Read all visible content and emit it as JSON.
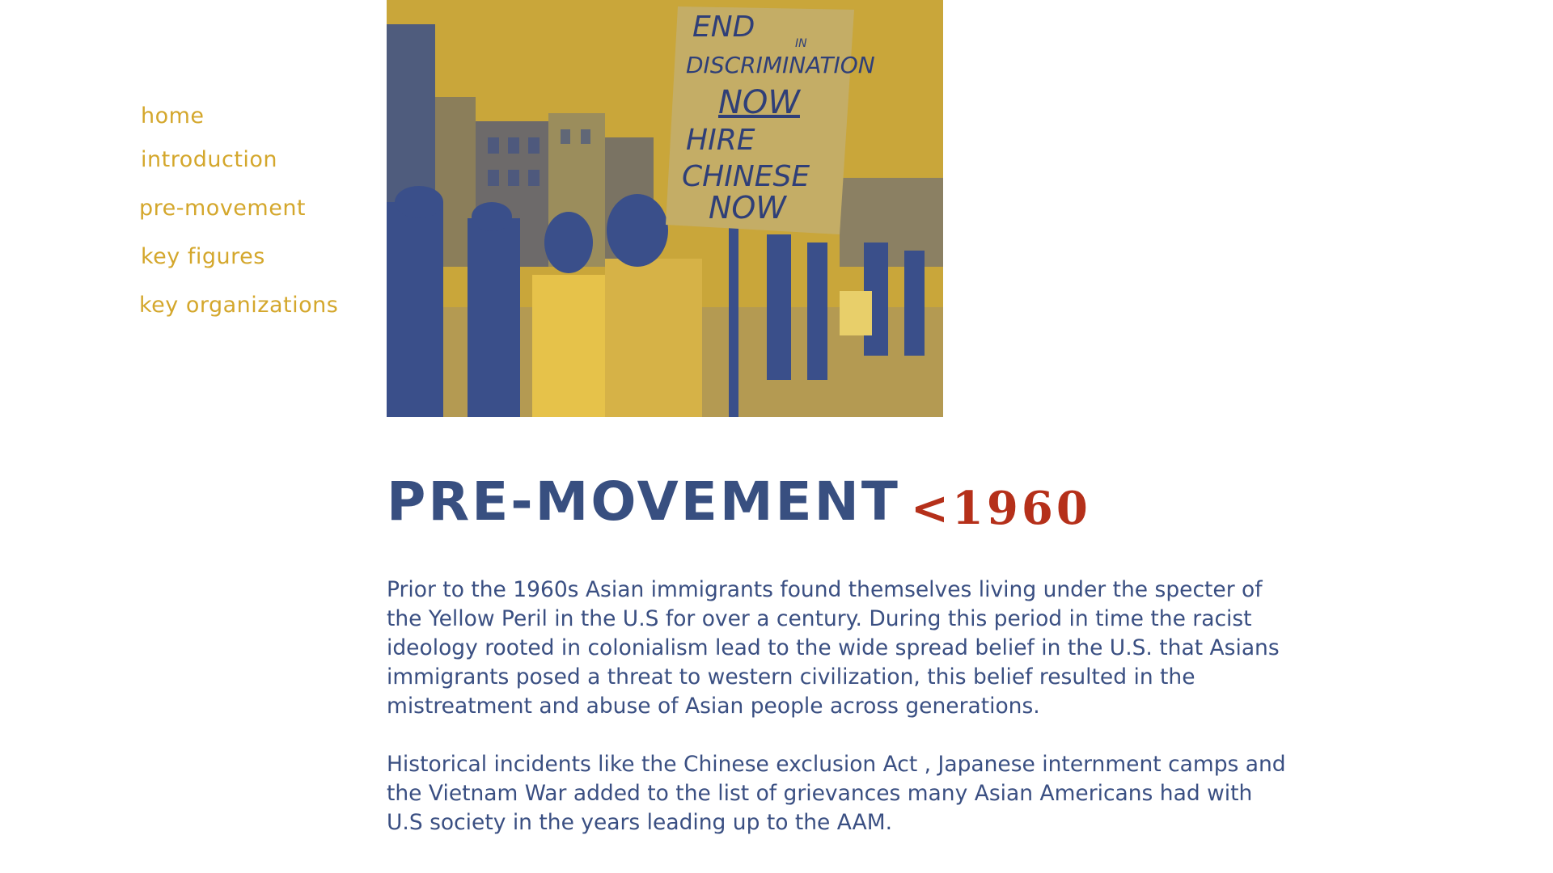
{
  "nav": {
    "items": [
      {
        "label": "home"
      },
      {
        "label": "introduction"
      },
      {
        "label": "pre-movement"
      },
      {
        "label": "key figures"
      },
      {
        "label": "key organizations"
      }
    ]
  },
  "hero_image": {
    "sign_text": [
      "END",
      "IN",
      "DISCRIMINATION",
      "NOW",
      "HIRE",
      "CHINESE",
      "NOW"
    ],
    "colors": {
      "yellow": "#d0aa3c",
      "blue": "#3a4f8a"
    }
  },
  "section": {
    "title": "PRE-MOVEMENT",
    "era": "<1960",
    "paragraphs": [
      "Prior to the 1960s Asian immigrants found themselves living under the specter of the Yellow Peril in the U.S for over a century. During this period in time the racist ideology rooted in colonialism lead to the wide spread belief in the U.S. that Asians immigrants posed a threat to western civilization, this belief resulted in the mistreatment and abuse of Asian people across generations.",
      "Historical incidents like the Chinese exclusion Act , Japanese internment camps and the Vietnam War added to the list of grievances many Asian Americans had with U.S society in the years leading up to the AAM."
    ]
  },
  "colors": {
    "nav": "#d4a72c",
    "title": "#384f80",
    "era": "#b5301a",
    "body": "#3a4f82"
  }
}
